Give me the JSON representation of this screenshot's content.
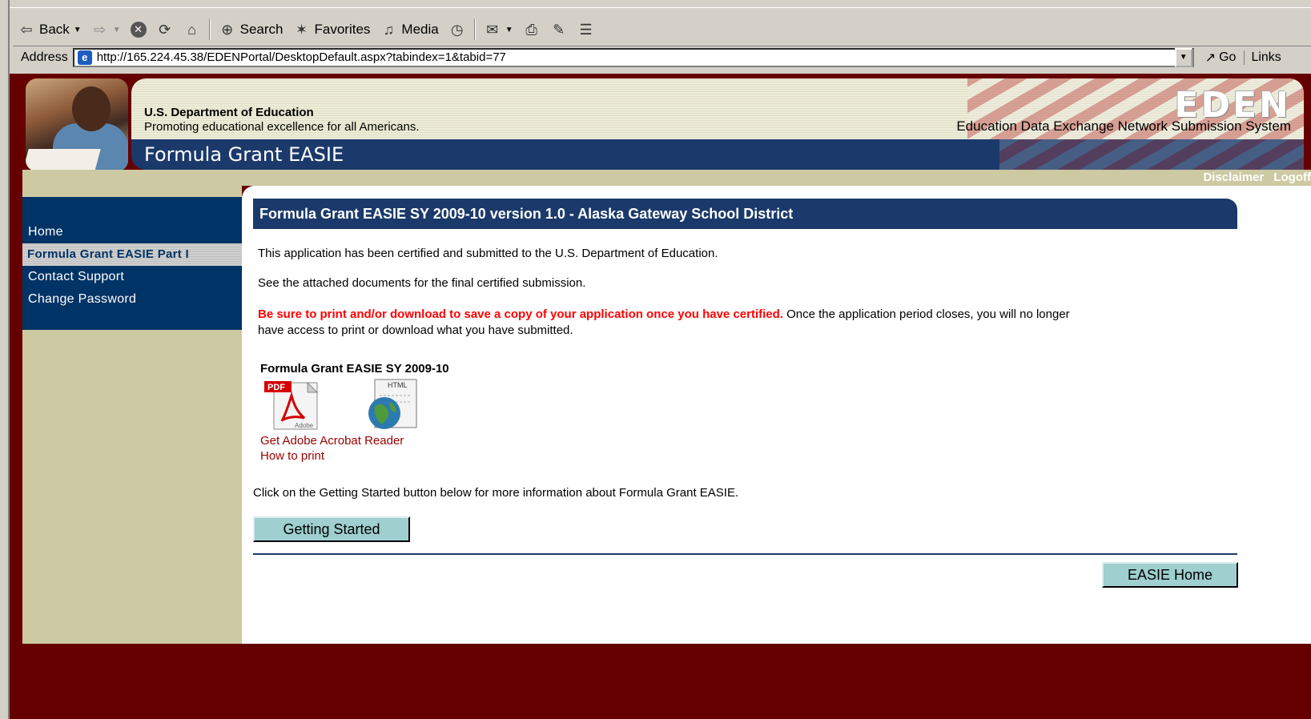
{
  "browser": {
    "toolbar": {
      "back_label": "Back",
      "search_label": "Search",
      "favorites_label": "Favorites",
      "media_label": "Media"
    },
    "address": {
      "label": "Address",
      "url": "http://165.224.45.38/EDENPortal/DesktopDefault.aspx?tabindex=1&tabid=77",
      "go_label": "Go",
      "links_label": "Links"
    }
  },
  "header": {
    "dept_name": "U.S. Department of Education",
    "dept_tagline": "Promoting educational excellence for all Americans.",
    "app_title": "Formula Grant EASIE",
    "logo_text": "EDEN",
    "system_name": "Education Data Exchange Network Submission System",
    "links": [
      "Disclaimer",
      "Logoff"
    ]
  },
  "nav": {
    "items": [
      {
        "label": "Home",
        "active": false
      },
      {
        "label": "Formula Grant EASIE Part I",
        "active": true
      },
      {
        "label": "Contact Support",
        "active": false
      },
      {
        "label": "Change Password",
        "active": false
      }
    ]
  },
  "content": {
    "title": "Formula Grant EASIE SY 2009-10 version 1.0 - Alaska Gateway School District",
    "msg_certified": "This application has been certified and submitted to the U.S. Department of Education.",
    "msg_attached": "See the attached documents for the final certified submission.",
    "msg_warning": "Be sure to print and/or download to save a copy of your application once you have certified.",
    "msg_warning_rest": " Once the application period closes, you will no longer have access to print or download what you have submitted.",
    "docs_title": "Formula Grant EASIE SY 2009-10",
    "pdf_label": "PDF",
    "pdf_brand": "Adobe",
    "html_label": "HTML",
    "link_acrobat": "Get Adobe Acrobat Reader",
    "link_print": "How to print",
    "msg_getting_started": "Click on the Getting Started button below for more information about Formula Grant EASIE.",
    "btn_getting_started": "Getting Started",
    "btn_easie_home": "EASIE Home"
  },
  "colors": {
    "page_bg": "#660000",
    "nav_bg": "#003366",
    "title_bar": "#1b3a6b",
    "sidebar_tan": "#cdc9a2",
    "warning_red": "#ff0000",
    "button_teal": "#9fcfcf"
  }
}
